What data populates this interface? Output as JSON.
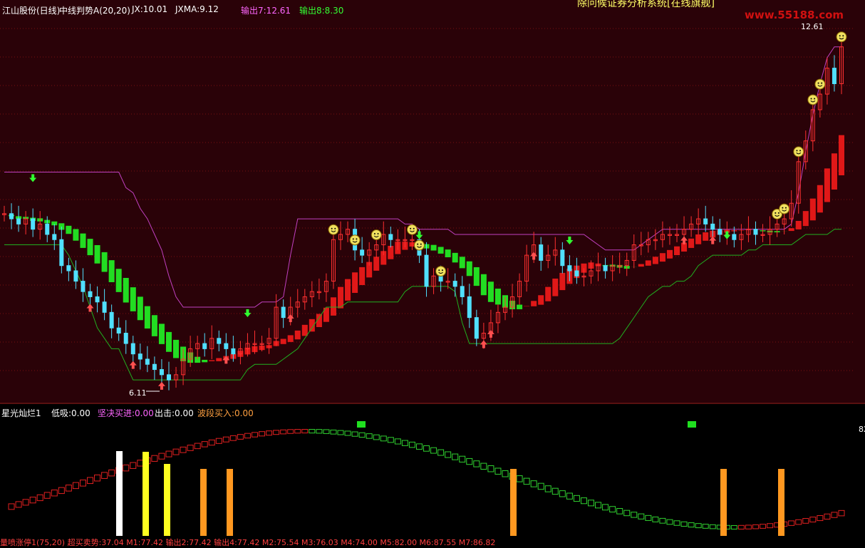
{
  "header": {
    "title": "江山股份(日线)",
    "indicator": "中线判势A(20,20)",
    "jx": "JX:10.01",
    "jxma": "JXMA:9.12",
    "out7": "输出7:12.61",
    "out8": "输出8:8.30",
    "top_banner": "除问候证券分析系统[在线旗舰]",
    "watermark": "www.55188.com"
  },
  "main_labels": {
    "high": "12.61",
    "low": "6.11"
  },
  "sub_header": {
    "name": "星光灿烂1",
    "dixi": "低吸:0.00",
    "buy": "坚决买进:0.00",
    "sell": "出击:0.00",
    "wave": "波段买入:0.00"
  },
  "sub_axis_label": "82",
  "bottom_row": "量喷涨停1(75,20)  超买卖势:37.04  M1:77.42  输出2:77.42  输出4:77.42  M2:75.54  M3:76.03  M4:74.00  M5:82.00  M6:87.55  M7:86.82",
  "colors": {
    "up": "#ff3030",
    "down": "#50e0ff",
    "ribbon_green": "#22dd22",
    "ribbon_red": "#e01818",
    "upper": "#c040c0",
    "lower": "#20b020",
    "grid": "#7a1010"
  },
  "chart_data": {
    "type": "candlestick",
    "price_range": [
      5.9,
      13.1
    ],
    "high_label": 12.61,
    "low_label": 6.11,
    "close": [
      9.4,
      9.3,
      9.2,
      9.3,
      9.1,
      9.2,
      9.0,
      8.9,
      8.4,
      8.3,
      8.1,
      7.9,
      7.8,
      7.7,
      7.5,
      7.2,
      7.1,
      6.9,
      6.7,
      6.6,
      6.5,
      6.4,
      6.3,
      6.2,
      6.3,
      6.6,
      6.8,
      6.9,
      6.8,
      7.0,
      6.9,
      6.8,
      6.7,
      6.8,
      6.9,
      6.9,
      6.9,
      7.0,
      7.6,
      7.4,
      7.6,
      7.7,
      7.8,
      7.9,
      7.9,
      8.1,
      8.9,
      9.0,
      9.1,
      8.7,
      8.6,
      8.7,
      8.8,
      9.0,
      8.9,
      8.9,
      8.9,
      8.9,
      8.6,
      8.0,
      8.2,
      8.1,
      8.1,
      8.0,
      7.8,
      7.4,
      7.0,
      7.1,
      7.3,
      7.5,
      7.6,
      7.8,
      8.1,
      8.6,
      8.8,
      8.5,
      8.6,
      8.7,
      8.4,
      8.3,
      8.2,
      8.2,
      8.3,
      8.4,
      8.3,
      8.4,
      8.4,
      8.5,
      8.8,
      8.8,
      8.9,
      8.9,
      9.0,
      9.0,
      9.0,
      9.1,
      9.2,
      9.3,
      9.2,
      9.1,
      9.0,
      9.0,
      8.9,
      9.0,
      9.1,
      9.0,
      9.0,
      9.1,
      9.2,
      9.3,
      9.6,
      10.4,
      10.8,
      11.4,
      11.7,
      12.2,
      11.9,
      12.61
    ],
    "upper_band": [
      10.2,
      10.2,
      10.2,
      10.2,
      10.2,
      10.2,
      10.2,
      10.2,
      10.2,
      10.2,
      10.2,
      10.2,
      10.2,
      10.2,
      10.2,
      10.2,
      10.2,
      9.9,
      9.8,
      9.5,
      9.3,
      9.0,
      8.7,
      8.2,
      7.8,
      7.6,
      7.6,
      7.6,
      7.6,
      7.6,
      7.6,
      7.6,
      7.6,
      7.6,
      7.6,
      7.6,
      7.7,
      7.7,
      7.7,
      7.8,
      8.6,
      9.3,
      9.3,
      9.3,
      9.3,
      9.3,
      9.3,
      9.3,
      9.3,
      9.3,
      9.3,
      9.3,
      9.3,
      9.3,
      9.3,
      9.3,
      9.2,
      9.2,
      9.1,
      9.1,
      9.1,
      9.1,
      9.1,
      9.0,
      9.0,
      9.0,
      9.0,
      9.0,
      9.0,
      9.0,
      9.0,
      9.0,
      9.0,
      9.0,
      9.0,
      9.0,
      9.0,
      9.0,
      9.0,
      9.0,
      9.0,
      9.0,
      8.9,
      8.8,
      8.7,
      8.7,
      8.7,
      8.7,
      8.7,
      8.8,
      8.9,
      9.0,
      9.1,
      9.1,
      9.1,
      9.1,
      9.1,
      9.1,
      9.1,
      9.1,
      9.1,
      9.1,
      9.1,
      9.1,
      9.1,
      9.1,
      9.1,
      9.1,
      9.1,
      9.1,
      9.2,
      9.8,
      10.6,
      11.3,
      11.9,
      12.4,
      12.61,
      12.61
    ],
    "lower_band": [
      8.8,
      8.8,
      8.8,
      8.8,
      8.8,
      8.8,
      8.8,
      8.8,
      8.8,
      8.6,
      8.3,
      8.0,
      7.6,
      7.2,
      7.0,
      6.8,
      6.8,
      6.5,
      6.2,
      6.2,
      6.2,
      6.2,
      6.2,
      6.2,
      6.2,
      6.2,
      6.2,
      6.2,
      6.2,
      6.2,
      6.2,
      6.2,
      6.2,
      6.2,
      6.4,
      6.5,
      6.5,
      6.5,
      6.5,
      6.6,
      6.7,
      6.8,
      7.0,
      7.2,
      7.4,
      7.6,
      7.6,
      7.6,
      7.7,
      7.7,
      7.7,
      7.7,
      7.7,
      7.7,
      7.7,
      7.7,
      7.9,
      8.0,
      8.0,
      8.0,
      8.0,
      8.0,
      8.0,
      7.9,
      7.3,
      6.9,
      6.9,
      6.9,
      6.9,
      6.9,
      6.9,
      6.9,
      6.9,
      6.9,
      6.9,
      6.9,
      6.9,
      6.9,
      6.9,
      6.9,
      6.9,
      6.9,
      6.9,
      6.9,
      6.9,
      6.9,
      7.0,
      7.2,
      7.4,
      7.6,
      7.8,
      7.9,
      8.0,
      8.0,
      8.1,
      8.1,
      8.2,
      8.4,
      8.5,
      8.6,
      8.6,
      8.6,
      8.6,
      8.6,
      8.7,
      8.7,
      8.8,
      8.8,
      8.8,
      8.8,
      8.8,
      8.9,
      9.0,
      9.0,
      9.0,
      9.0,
      9.1,
      9.1
    ]
  }
}
